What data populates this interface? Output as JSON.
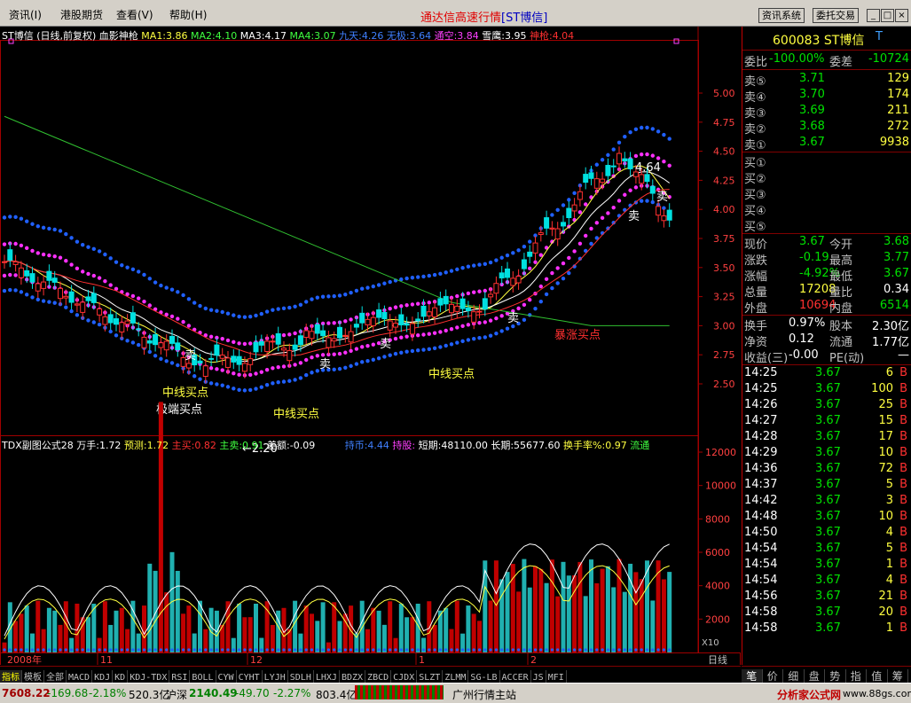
{
  "menu": {
    "items": [
      "资讯(I)",
      "港股期货",
      "查看(V)",
      "帮助(H)"
    ],
    "title": "通达信高速行情",
    "title_stock": "[ST博信]",
    "btn_info": "资讯系统",
    "btn_trade": "委托交易"
  },
  "main": {
    "header": {
      "name": "ST博信",
      "period": "(日线,前复权)",
      "indicator": "血影神枪",
      "ma1": "MA1:3.86",
      "ma2": "MA2:4.10",
      "ma3": "MA3:4.17",
      "ma4": "MA4:3.07",
      "jiutian": "九天:4.26",
      "wuji": "无极:3.64",
      "tongkong": "通空:3.84",
      "xueying": "雪鹰:3.95",
      "shenqiang": "神枪:4.04"
    },
    "price_axis": [
      "5.00",
      "4.75",
      "4.50",
      "4.25",
      "4.00",
      "3.75",
      "3.50",
      "3.25",
      "3.00",
      "2.75",
      "2.50"
    ],
    "annotations": {
      "high": "4.64",
      "low": "2.20",
      "sell": "卖",
      "mid_buy": "中线买点",
      "bottom_buy": "极端买点",
      "rally_buy": "暴涨买点"
    },
    "sub_header": {
      "name": "TDX副图公式28",
      "wanshou": "万手:1.72",
      "yuce": "预测:1.72",
      "zhumai": "主买:0.82",
      "zhumai2": "主卖:0.91",
      "chae": "差额:-0.09",
      "chibi": "持币:4.44",
      "chigu": "持股:",
      "duanqi": "短期:48110.00",
      "changqi": "长期:55677.60",
      "huanshou": "换手率%:0.97",
      "liutong": "流通"
    },
    "vol_axis": [
      "12000",
      "10000",
      "8000",
      "6000",
      "4000",
      "2000"
    ],
    "vol_unit": "X10",
    "date_axis": [
      "2008年",
      "11",
      "12",
      "1",
      "2"
    ],
    "period_label": "日线"
  },
  "tabs": [
    "指标",
    "模板",
    "全部",
    "MACD",
    "KDJ",
    "KD",
    "KDJ-TDX",
    "RSI",
    "BOLL",
    "CYW",
    "CYHT",
    "LYJH",
    "SDLH",
    "LHXJ",
    "BDZX",
    "ZBCD",
    "CJDX",
    "SLZT",
    "ZLMM",
    "SG-LB",
    "ACCER",
    "JS",
    "MFI"
  ],
  "right": {
    "code": "600083",
    "name": "ST博信",
    "code_mark": "T",
    "weibi_label": "委比",
    "weibi": "-100.00%",
    "weicha_label": "委差",
    "weicha": "-10724",
    "sells": [
      {
        "l": "卖⑤",
        "p": "3.71",
        "v": "129"
      },
      {
        "l": "卖④",
        "p": "3.70",
        "v": "174"
      },
      {
        "l": "卖③",
        "p": "3.69",
        "v": "211"
      },
      {
        "l": "卖②",
        "p": "3.68",
        "v": "272"
      },
      {
        "l": "卖①",
        "p": "3.67",
        "v": "9938"
      }
    ],
    "buys": [
      {
        "l": "买①"
      },
      {
        "l": "买②"
      },
      {
        "l": "买③"
      },
      {
        "l": "买④"
      },
      {
        "l": "买⑤"
      }
    ],
    "stats": [
      {
        "a": "现价",
        "av": "3.67",
        "ac": "grn",
        "b": "今开",
        "bv": "3.68",
        "bc": "grn"
      },
      {
        "a": "涨跌",
        "av": "-0.19",
        "ac": "grn",
        "b": "最高",
        "bv": "3.77",
        "bc": "grn"
      },
      {
        "a": "涨幅",
        "av": "-4.92%",
        "ac": "grn",
        "b": "最低",
        "bv": "3.67",
        "bc": "grn"
      },
      {
        "a": "总量",
        "av": "17208",
        "ac": "yel",
        "b": "量比",
        "bv": "0.34",
        "bc": "wht"
      },
      {
        "a": "外盘",
        "av": "10694",
        "ac": "red",
        "b": "内盘",
        "bv": "6514",
        "bc": "grn"
      }
    ],
    "stats2": [
      {
        "a": "换手",
        "av": "0.97%",
        "b": "股本",
        "bv": "2.30亿"
      },
      {
        "a": "净资",
        "av": "0.12",
        "b": "流通",
        "bv": "1.77亿"
      },
      {
        "a": "收益(三)",
        "av": "-0.00",
        "b": "PE(动)",
        "bv": "—"
      }
    ],
    "ticks": [
      {
        "t": "14:25",
        "p": "3.67",
        "v": "6",
        "s": "B"
      },
      {
        "t": "14:25",
        "p": "3.67",
        "v": "100",
        "s": "B"
      },
      {
        "t": "14:26",
        "p": "3.67",
        "v": "25",
        "s": "B"
      },
      {
        "t": "14:27",
        "p": "3.67",
        "v": "15",
        "s": "B"
      },
      {
        "t": "14:28",
        "p": "3.67",
        "v": "17",
        "s": "B"
      },
      {
        "t": "14:29",
        "p": "3.67",
        "v": "10",
        "s": "B"
      },
      {
        "t": "14:36",
        "p": "3.67",
        "v": "72",
        "s": "B"
      },
      {
        "t": "14:37",
        "p": "3.67",
        "v": "5",
        "s": "B"
      },
      {
        "t": "14:42",
        "p": "3.67",
        "v": "3",
        "s": "B"
      },
      {
        "t": "14:48",
        "p": "3.67",
        "v": "10",
        "s": "B"
      },
      {
        "t": "14:50",
        "p": "3.67",
        "v": "4",
        "s": "B"
      },
      {
        "t": "14:54",
        "p": "3.67",
        "v": "5",
        "s": "B"
      },
      {
        "t": "14:54",
        "p": "3.67",
        "v": "1",
        "s": "B"
      },
      {
        "t": "14:54",
        "p": "3.67",
        "v": "4",
        "s": "B"
      },
      {
        "t": "14:56",
        "p": "3.67",
        "v": "21",
        "s": "B"
      },
      {
        "t": "14:58",
        "p": "3.67",
        "v": "20",
        "s": "B"
      },
      {
        "t": "14:58",
        "p": "3.67",
        "v": "1",
        "s": "B"
      }
    ],
    "tabs": [
      "笔",
      "价",
      "细",
      "盘",
      "势",
      "指",
      "值",
      "筹"
    ]
  },
  "status": {
    "sh_idx": "7608.22",
    "sh_chg": "-169.68",
    "sh_pct": "-2.18%",
    "sh_amt": "520.3亿",
    "hs_label": "沪深",
    "hs_idx": "2140.49",
    "hs_chg": "-49.70",
    "hs_pct": "-2.27%",
    "hs_amt": "803.4亿",
    "server": "广州行情主站",
    "site": "分析家公式网",
    "site_url": "www.88gs.com"
  },
  "colors": {
    "up": "#ff3030",
    "down": "#00e0e0",
    "blue_dots": "#2060ff",
    "magenta_dots": "#ff30ff"
  }
}
